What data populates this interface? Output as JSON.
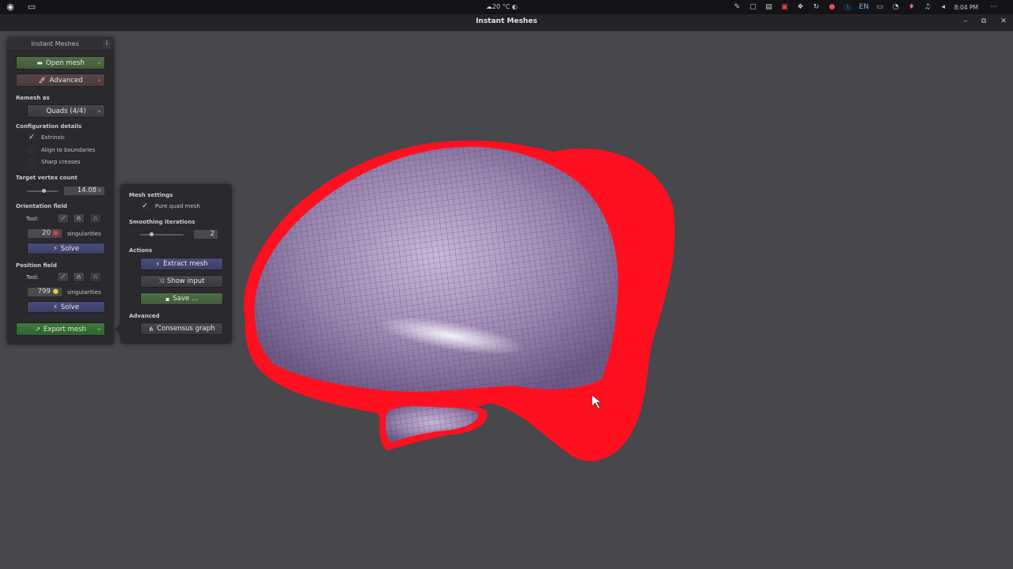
{
  "system_bar": {
    "weather": "20 °C",
    "language": "EN",
    "time": "8:04 PM"
  },
  "window": {
    "title": "Instant Meshes"
  },
  "main_panel": {
    "title": "Instant Meshes",
    "info_label": "i",
    "open_mesh_label": "Open mesh",
    "advanced_label": "Advanced",
    "remesh_as_label": "Remesh as",
    "remesh_as_value": "Quads (4/4)",
    "config_label": "Configuration details",
    "extrinsic_label": "Extrinsic",
    "extrinsic_checked": true,
    "align_label": "Align to boundaries",
    "sharp_label": "Sharp creases",
    "target_vertex_label": "Target vertex count",
    "target_vertex_value": "14.08",
    "target_vertex_unit": "K",
    "orientation_label": "Orientation field",
    "tool_label": "Tool:",
    "orientation_singularities": "20",
    "singularities_label": "singularities",
    "solve_label": "Solve",
    "position_label": "Position field",
    "position_singularities": "799",
    "export_label": "Export mesh"
  },
  "settings_panel": {
    "mesh_settings_label": "Mesh settings",
    "pure_quad_label": "Pure quad mesh",
    "pure_quad_checked": true,
    "smoothing_label": "Smoothing iterations",
    "smoothing_value": "2",
    "actions_label": "Actions",
    "extract_label": "Extract mesh",
    "show_input_label": "Show input",
    "save_label": "Save ...",
    "advanced_label": "Advanced",
    "consensus_label": "Consensus graph"
  },
  "colors": {
    "accent_green": "#4f6f45",
    "accent_blue": "#4a4d79",
    "mesh_edge_red": "#ff1020",
    "mesh_surface": "#a58fb8"
  }
}
